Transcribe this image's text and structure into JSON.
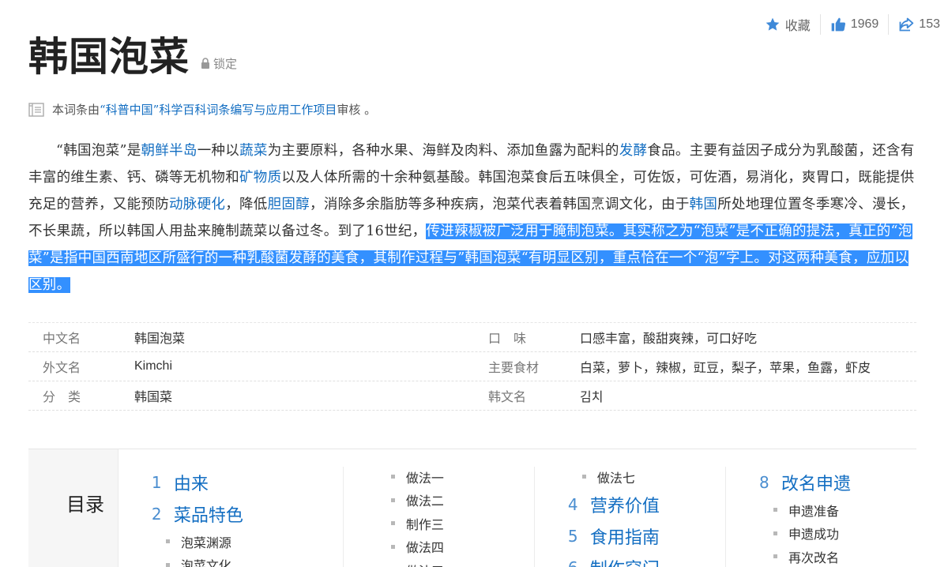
{
  "actions": {
    "favorite_label": "收藏",
    "like_count": "1969",
    "share_count": "153"
  },
  "title": "韩国泡菜",
  "lock_label": "锁定",
  "review": {
    "prefix": "本词条由",
    "link": "“科普中国”科学百科词条编写与应用工作项目",
    "suffix": " 审核 。"
  },
  "summary": {
    "seg1": "“韩国泡菜”是",
    "link1": "朝鲜半岛",
    "seg2": "一种以",
    "link2": "蔬菜",
    "seg3": "为主要原料，各种水果、海鲜及肉料、添加鱼露为配料的",
    "link3": "发酵",
    "seg4": "食品。主要有益因子成分为乳酸菌，还含有丰富的维生素、钙、磷等无机物和",
    "link4": "矿物质",
    "seg5": "以及人体所需的十余种氨基酸。韩国泡菜食后五味俱全，可佐饭，可佐酒，易消化，爽胃口，既能提供充足的营养，又能预防",
    "link5": "动脉硬化",
    "seg6": "，降低",
    "link6": "胆固醇",
    "seg7": "，消除多余脂肪等多种疾病，泡菜代表着韩国烹调文化，由于",
    "link7": "韩国",
    "seg8": "所处地理位置冬季寒冷、漫长，不长果蔬，所以韩国人用盐来腌制蔬菜以备过冬。到了16世纪，",
    "highlight": "传进辣椒被广泛用于腌制泡菜。其实称之为“泡菜”是不正确的提法，真正的“泡菜”是指中国西南地区所盛行的一种乳酸菌发酵的美食，其制作过程与”韩国泡菜“有明显区别，重点恰在一个“泡”字上。对这两种美食，应加以区别。"
  },
  "info": [
    {
      "k": "中文名",
      "v": "韩国泡菜",
      "k2": "口　味",
      "v2": "口感丰富，酸甜爽辣，可口好吃"
    },
    {
      "k": "外文名",
      "v": "Kimchi",
      "k2": "主要食材",
      "v2": "白菜，萝卜，辣椒，豇豆，梨子，苹果，鱼露，虾皮"
    },
    {
      "k": "分　类",
      "v": "韩国菜",
      "k2": "韩文名",
      "v2": "김치"
    }
  ],
  "catalog": {
    "heading": "目录",
    "col1": {
      "i1_num": "1",
      "i1": "由来",
      "i2_num": "2",
      "i2": "菜品特色",
      "s1": "泡菜渊源",
      "s2": "泡菜文化"
    },
    "col2": {
      "s1": "做法一",
      "s2": "做法二",
      "s3": "制作三",
      "s4": "做法四",
      "s5": "做法五"
    },
    "col3": {
      "s1": "做法七",
      "i4_num": "4",
      "i4": "营养价值",
      "i5_num": "5",
      "i5": "食用指南",
      "i6_num": "6",
      "i6": "制作窍门"
    },
    "col4": {
      "i8_num": "8",
      "i8": "改名申遗",
      "s1": "申遗准备",
      "s2": "申遗成功",
      "s3": "再次改名"
    }
  },
  "colors": {
    "link": "#136ec2",
    "highlight": "#3390ff",
    "icon_blue": "#3e89d8"
  }
}
